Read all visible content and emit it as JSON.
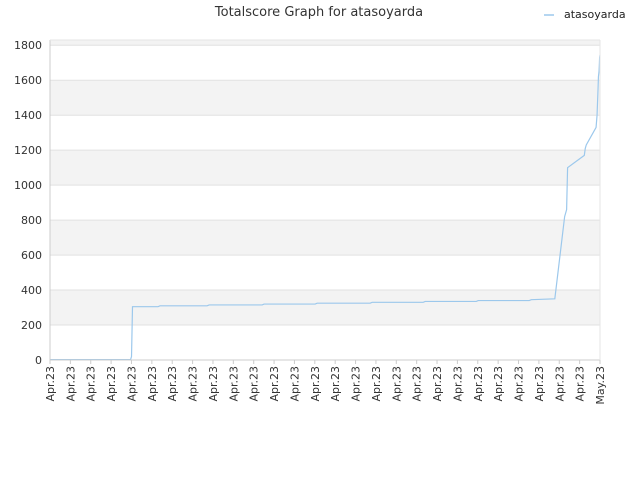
{
  "chart_data": {
    "type": "line",
    "title": "Totalscore Graph for atasoyarda",
    "xlabel": "",
    "ylabel": "",
    "ylim": [
      0,
      1830
    ],
    "y_ticks": [
      0,
      200,
      400,
      600,
      800,
      1000,
      1200,
      1400,
      1600,
      1800
    ],
    "x_tick_labels": [
      "Apr.23",
      "Apr.23",
      "Apr.23",
      "Apr.23",
      "Apr.23",
      "Apr.23",
      "Apr.23",
      "Apr.23",
      "Apr.23",
      "Apr.23",
      "Apr.23",
      "Apr.23",
      "Apr.23",
      "Apr.23",
      "Apr.23",
      "Apr.23",
      "Apr.23",
      "Apr.23",
      "Apr.23",
      "Apr.23",
      "Apr.23",
      "Apr.23",
      "Apr.23",
      "Apr.23",
      "Apr.23",
      "Apr.23",
      "Apr.23",
      "May.23"
    ],
    "grid": true,
    "legend_position": "top-right",
    "series": [
      {
        "name": "atasoyarda",
        "color": "#9cc8ec",
        "x": [
          0,
          0.4,
          4.1,
          4.15,
          4.2,
          5.5,
          5.6,
          8.0,
          8.1,
          10.8,
          10.9,
          13.5,
          13.6,
          16.3,
          16.4,
          19.0,
          19.1,
          21.7,
          21.8,
          24.4,
          24.5,
          25.7,
          26.2,
          26.3,
          26.35,
          27.2,
          27.25,
          27.3,
          27.8,
          27.85,
          27.9,
          27.92,
          27.95,
          27.97,
          27.98,
          28.0
        ],
        "values": [
          2,
          2,
          2,
          20,
          305,
          305,
          310,
          310,
          315,
          315,
          320,
          320,
          325,
          325,
          330,
          330,
          335,
          335,
          340,
          340,
          345,
          350,
          820,
          860,
          1100,
          1170,
          1210,
          1230,
          1330,
          1400,
          1550,
          1620,
          1650,
          1700,
          1730,
          1745
        ]
      }
    ],
    "x_range": [
      0,
      28
    ]
  }
}
